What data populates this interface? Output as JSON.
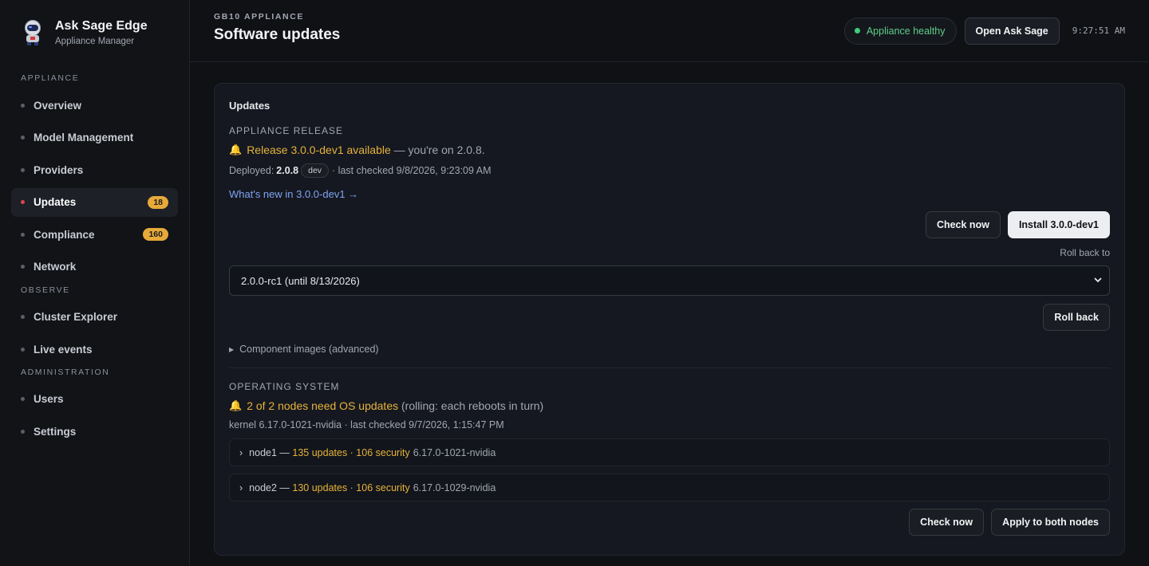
{
  "brand": {
    "name": "Ask Sage Edge",
    "subtitle": "Appliance Manager"
  },
  "sidebar": {
    "sections": [
      {
        "label": "APPLIANCE"
      },
      {
        "label": "OBSERVE"
      },
      {
        "label": "ADMINISTRATION"
      }
    ],
    "items": [
      {
        "label": "Overview"
      },
      {
        "label": "Model Management"
      },
      {
        "label": "Providers"
      },
      {
        "label": "Updates",
        "badge": "18"
      },
      {
        "label": "Compliance",
        "badge": "160"
      },
      {
        "label": "Network"
      },
      {
        "label": "Cluster Explorer"
      },
      {
        "label": "Live events"
      },
      {
        "label": "Users"
      },
      {
        "label": "Settings"
      }
    ]
  },
  "header": {
    "eyebrow": "GB10 APPLIANCE",
    "title": "Software updates",
    "health": "Appliance healthy",
    "open_button": "Open Ask Sage",
    "clock": "9:27:51 AM"
  },
  "card": {
    "title": "Updates",
    "release": {
      "section_label": "APPLIANCE RELEASE",
      "available": "Release 3.0.0-dev1 available",
      "current": " — you're on 2.0.8.",
      "deployed_label": "Deployed:",
      "deployed_version": "2.0.8",
      "channel": "dev",
      "last_checked": "· last checked 9/8/2026, 9:23:09 AM",
      "whats_new": "What's new in 3.0.0-dev1 →",
      "check_now": "Check now",
      "install": "Install 3.0.0-dev1",
      "rollback_label": "Roll back to",
      "rollback_selected": "2.0.0-rc1 (until 8/13/2026)",
      "rollback_button": "Roll back",
      "components": "Component images (advanced)"
    },
    "os": {
      "section_label": "OPERATING SYSTEM",
      "summary": "2 of 2 nodes need OS updates",
      "summary_note": " (rolling: each reboots in turn)",
      "kernel": "kernel 6.17.0-1021-nvidia · last checked 9/7/2026, 1:15:47 PM",
      "nodes": [
        {
          "name": "node1 — ",
          "updates": "135 updates · 106 security",
          "kernel": "6.17.0-1021-nvidia"
        },
        {
          "name": "node2 — ",
          "updates": "130 updates · 106 security",
          "kernel": "6.17.0-1029-nvidia"
        }
      ],
      "check_now": "Check now",
      "apply": "Apply to both nodes"
    }
  },
  "colors": {
    "accent_amber": "#e6b23a",
    "healthy_green": "#3ecf7a",
    "link_blue": "#7ea3f2",
    "active_dot": "#e0454c"
  }
}
